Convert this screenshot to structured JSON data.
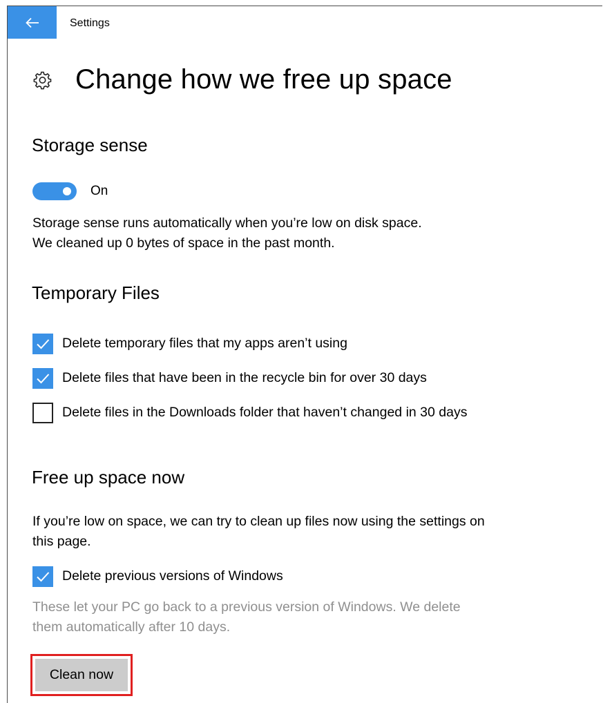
{
  "header": {
    "app_title": "Settings",
    "back_icon": "back-arrow-icon"
  },
  "page": {
    "title": "Change how we free up space",
    "title_icon": "gear-icon"
  },
  "storage_sense": {
    "heading": "Storage sense",
    "toggle_state": true,
    "toggle_label": "On",
    "description_line1": "Storage sense runs automatically when you’re low on disk space.",
    "description_line2": "We cleaned up 0 bytes of space in the past month."
  },
  "temporary_files": {
    "heading": "Temporary Files",
    "options": [
      {
        "label": "Delete temporary files that my apps aren’t using",
        "checked": true
      },
      {
        "label": "Delete files that have been in the recycle bin for over 30 days",
        "checked": true
      },
      {
        "label": "Delete files in the Downloads folder that haven’t changed in 30 days",
        "checked": false
      }
    ]
  },
  "free_up_now": {
    "heading": "Free up space now",
    "description": "If you’re low on space, we can try to clean up files now using the settings on this page.",
    "option": {
      "label": "Delete previous versions of Windows",
      "checked": true
    },
    "note": "These let your PC go back to a previous version of Windows. We delete them automatically after 10 days.",
    "button_label": "Clean now"
  },
  "colors": {
    "accent": "#3a91e6",
    "highlight_border": "#e02020",
    "button_bg": "#cccccc",
    "muted_text": "#8f8f8f"
  }
}
